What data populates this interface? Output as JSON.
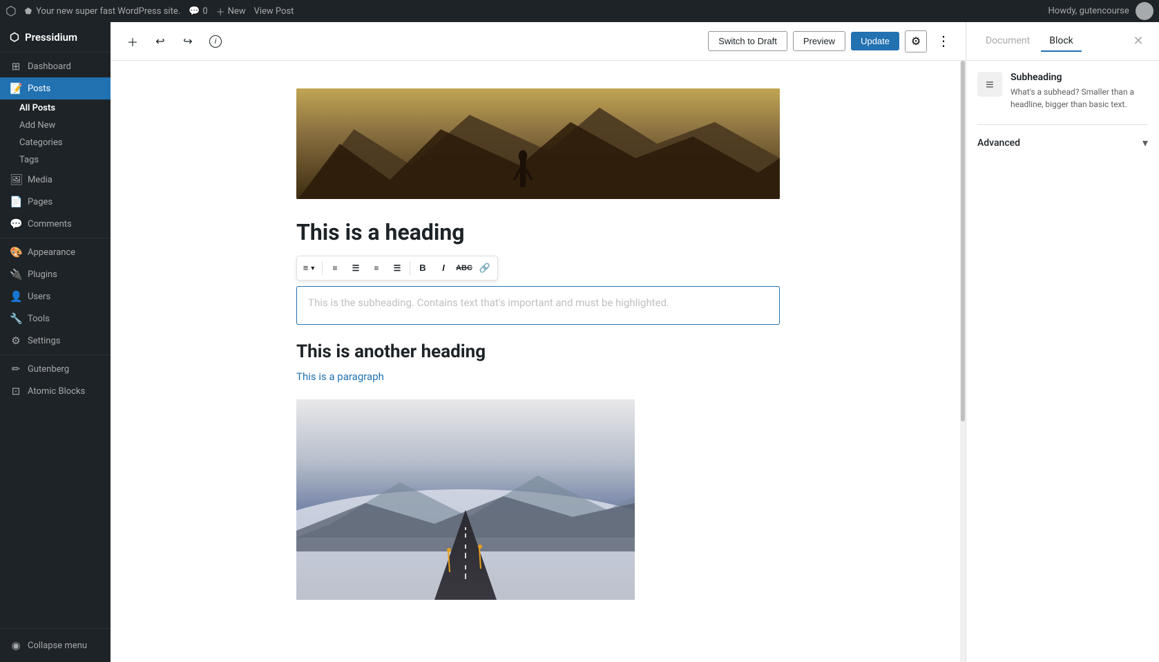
{
  "adminBar": {
    "logo": "W",
    "siteName": "Your new super fast WordPress site.",
    "comments": "0",
    "new": "New",
    "viewPost": "View Post",
    "greeting": "Howdy, gutencourse"
  },
  "sidebar": {
    "brand": "Pressidium",
    "items": [
      {
        "id": "dashboard",
        "label": "Dashboard",
        "icon": "⊞"
      },
      {
        "id": "posts",
        "label": "Posts",
        "icon": "📝",
        "active": true,
        "sub": [
          "All Posts",
          "Add New",
          "Categories",
          "Tags"
        ]
      },
      {
        "id": "media",
        "label": "Media",
        "icon": "🖼"
      },
      {
        "id": "pages",
        "label": "Pages",
        "icon": "📄"
      },
      {
        "id": "comments",
        "label": "Comments",
        "icon": "💬"
      },
      {
        "id": "appearance",
        "label": "Appearance",
        "icon": "🎨"
      },
      {
        "id": "plugins",
        "label": "Plugins",
        "icon": "🔌"
      },
      {
        "id": "users",
        "label": "Users",
        "icon": "👤"
      },
      {
        "id": "tools",
        "label": "Tools",
        "icon": "🔧"
      },
      {
        "id": "settings",
        "label": "Settings",
        "icon": "⚙"
      },
      {
        "id": "gutenberg",
        "label": "Gutenberg",
        "icon": "✏"
      },
      {
        "id": "atomic-blocks",
        "label": "Atomic Blocks",
        "icon": "⊡"
      }
    ],
    "collapse": "Collapse menu"
  },
  "toolbar": {
    "add_block_label": "+",
    "undo_label": "↩",
    "redo_label": "↪",
    "info_label": "ℹ",
    "switch_draft_label": "Switch to Draft",
    "preview_label": "Preview",
    "update_label": "Update",
    "settings_label": "⚙",
    "more_label": "⋮"
  },
  "content": {
    "heading": "This is a heading",
    "subheading_placeholder": "This is the subheading. Contains text that's important and must be highlighted.",
    "another_heading": "This is another heading",
    "paragraph": "This is a paragraph"
  },
  "rightPanel": {
    "tabs": [
      {
        "id": "document",
        "label": "Document",
        "active": false
      },
      {
        "id": "block",
        "label": "Block",
        "active": true
      }
    ],
    "block": {
      "icon": "≡",
      "name": "Subheading",
      "description": "What's a subhead? Smaller than a headline, bigger than basic text."
    },
    "advanced": {
      "label": "Advanced"
    }
  }
}
